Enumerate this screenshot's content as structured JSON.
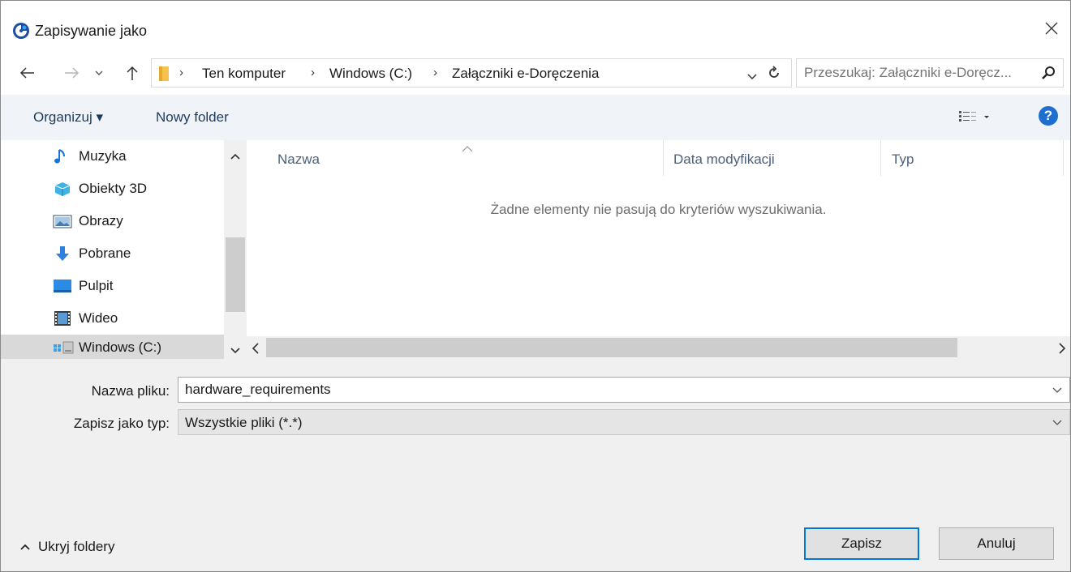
{
  "window": {
    "title": "Zapisywanie jako",
    "app_icon": "app-logo-icon",
    "close_icon": "close-icon"
  },
  "navigation": {
    "back_icon": "arrow-left-icon",
    "forward_icon": "arrow-right-icon",
    "recent_icon": "chevron-down-icon",
    "up_icon": "arrow-up-icon"
  },
  "address": {
    "folder_icon": "folder-icon",
    "breadcrumbs": [
      "Ten komputer",
      "Windows (C:)",
      "Załączniki e-Doręczenia"
    ],
    "separator": "›",
    "dropdown_icon": "chevron-down-icon",
    "refresh_icon": "refresh-icon"
  },
  "search": {
    "placeholder": "Przeszukaj: Załączniki e-Doręcz...",
    "icon": "search-icon"
  },
  "toolbar": {
    "organize_label": "Organizuj ▾",
    "new_folder_label": "Nowy folder",
    "view_icon": "view-options-icon",
    "help_icon": "help-icon",
    "help_label": "?"
  },
  "sidebar": {
    "items": [
      {
        "label": "Muzyka",
        "icon": "music-icon"
      },
      {
        "label": "Obiekty 3D",
        "icon": "cube-3d-icon"
      },
      {
        "label": "Obrazy",
        "icon": "pictures-icon"
      },
      {
        "label": "Pobrane",
        "icon": "download-icon"
      },
      {
        "label": "Pulpit",
        "icon": "desktop-icon"
      },
      {
        "label": "Wideo",
        "icon": "video-icon"
      },
      {
        "label": "Windows (C:)",
        "icon": "drive-icon",
        "selected": true
      }
    ]
  },
  "filelist": {
    "columns": [
      "Nazwa",
      "Data modyfikacji",
      "Typ"
    ],
    "sort_icon": "sort-up-icon",
    "empty_message": "Żadne elementy nie pasują do kryteriów wyszukiwania."
  },
  "form": {
    "filename_label": "Nazwa pliku:",
    "filename_value": "hardware_requirements",
    "type_label": "Zapisz jako typ:",
    "type_value": "Wszystkie pliki (*.*)"
  },
  "footer": {
    "hide_folders_label": "Ukryj foldery",
    "save_label": "Zapisz",
    "cancel_label": "Anuluj"
  },
  "colors": {
    "accent": "#0078d7",
    "toolbar_bg": "#f0f4f9",
    "selected_bg": "#d9d9d9"
  }
}
